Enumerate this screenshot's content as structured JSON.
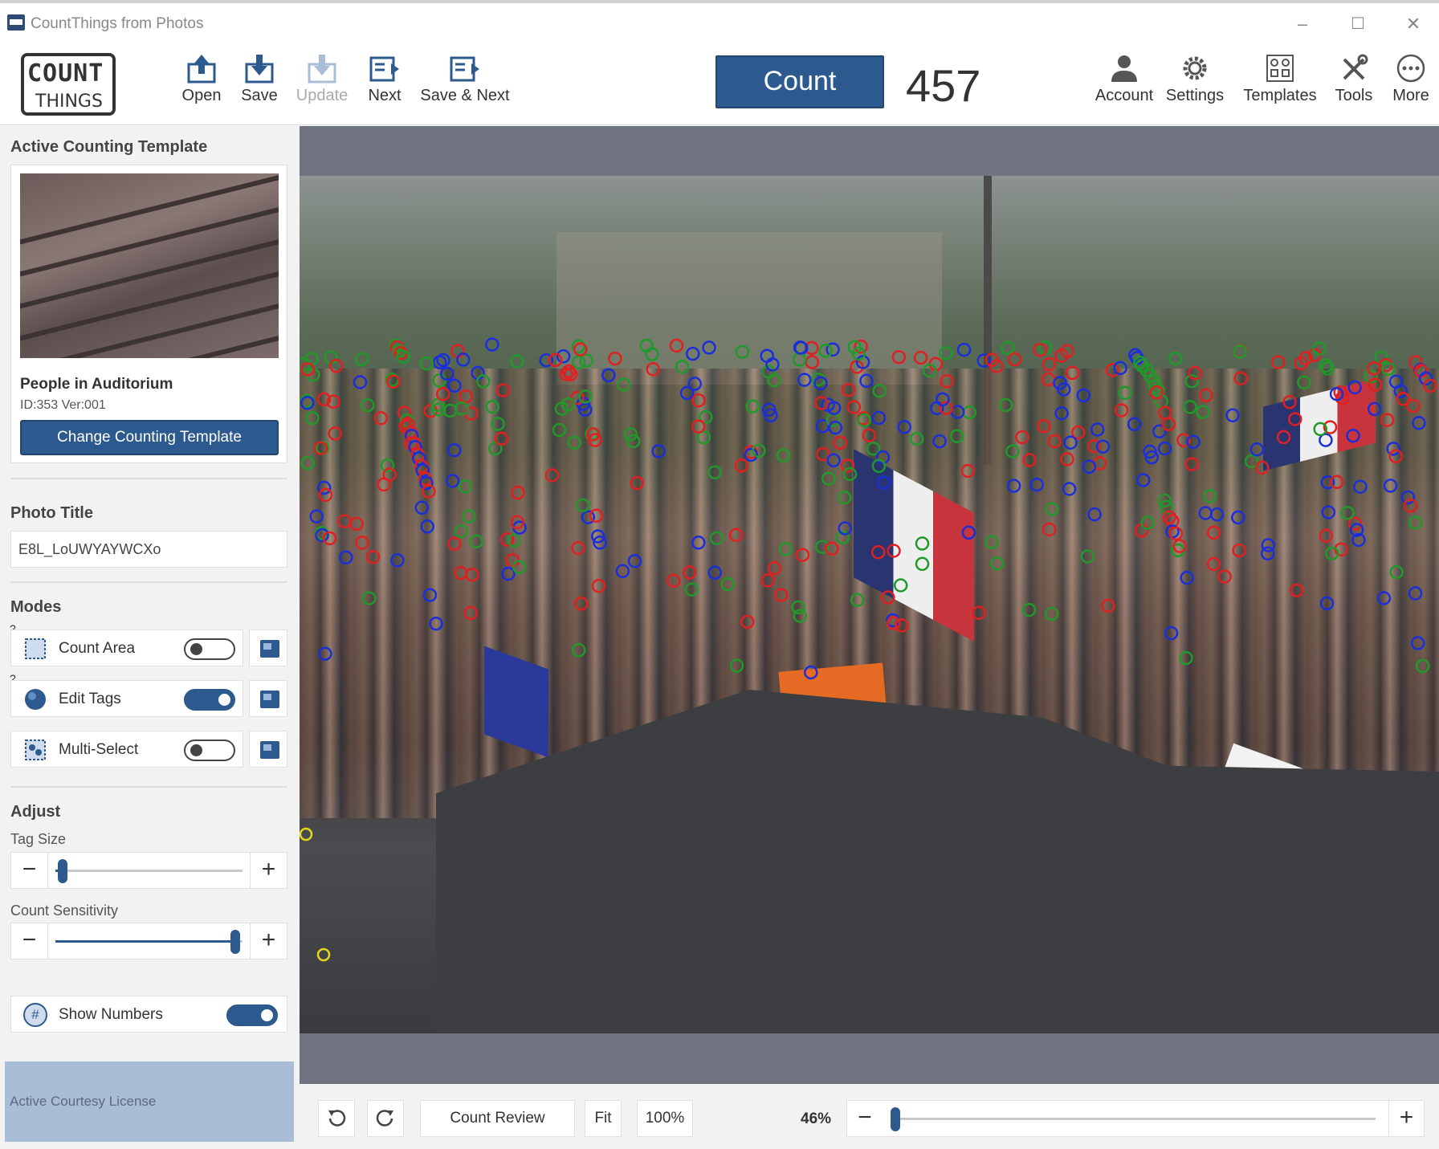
{
  "window": {
    "title": "CountThings from Photos",
    "controls": [
      "minimize",
      "maximize",
      "close"
    ]
  },
  "logo": {
    "line1": "COUNT",
    "line2": "THINGS"
  },
  "toolbar": {
    "open": "Open",
    "save": "Save",
    "update": "Update",
    "next": "Next",
    "save_next": "Save & Next",
    "count_button": "Count",
    "count_value": "457",
    "account": "Account",
    "settings": "Settings",
    "templates": "Templates",
    "tools": "Tools",
    "more": "More"
  },
  "sidebar": {
    "template_section": "Active Counting Template",
    "template_name": "People in Auditorium",
    "template_id": "ID:353 Ver:001",
    "change_template": "Change Counting Template",
    "photo_title_section": "Photo Title",
    "photo_title_value": "E8L_LoUWYAYWCXo",
    "modes_section": "Modes",
    "modes": [
      {
        "label": "Count Area",
        "on": false,
        "help": "?"
      },
      {
        "label": "Edit Tags",
        "on": true,
        "help": "?"
      },
      {
        "label": "Multi-Select",
        "on": false
      }
    ],
    "adjust_section": "Adjust",
    "tag_size_label": "Tag Size",
    "tag_size_level": 0.04,
    "count_sensitivity_label": "Count Sensitivity",
    "count_sensitivity_level": 0.96,
    "show_numbers_label": "Show Numbers",
    "show_numbers_icon": "#",
    "show_numbers_on": true,
    "license": "Active Courtesy License"
  },
  "bottombar": {
    "count_review": "Count Review",
    "fit": "Fit",
    "hundred": "100%",
    "zoom_value": "46%",
    "zoom_level": 0.0
  },
  "colors": {
    "accent": "#2d5a8e",
    "tag_red": "#e02020",
    "tag_green": "#1f9a2a",
    "tag_blue": "#1a2fd8",
    "tag_yellow": "#e8d81a"
  }
}
